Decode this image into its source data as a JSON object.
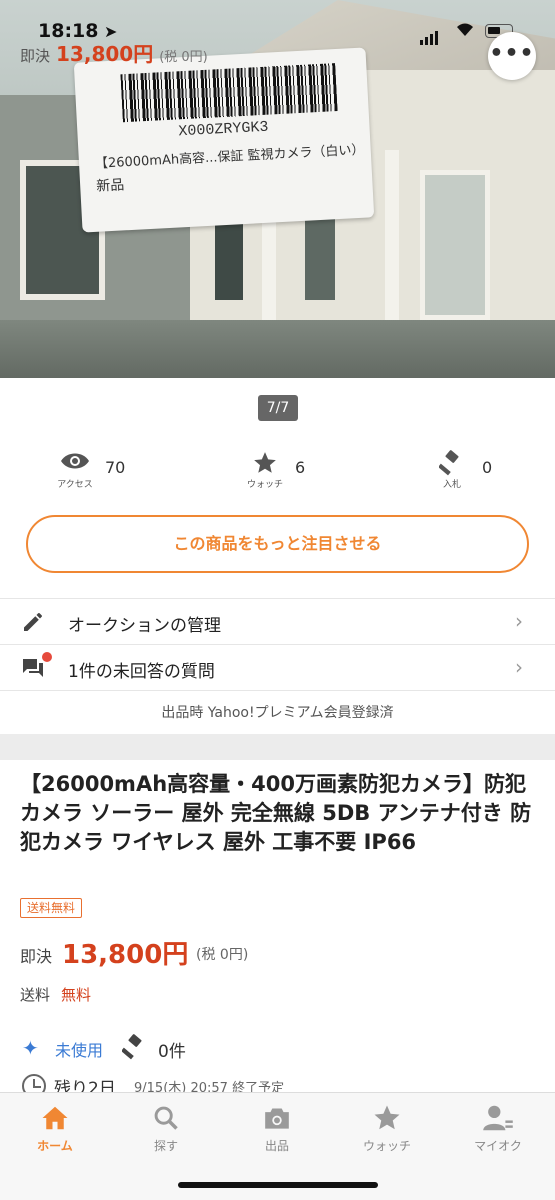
{
  "status_bar": {
    "time": "18:18"
  },
  "header_overlay": {
    "buy_label": "即決",
    "price": "13,800円",
    "tax": "(税 0円)"
  },
  "photo": {
    "sticker_code": "X000ZRYGK3",
    "sticker_line": "【26000mAh高容...保証 監視カメラ（白い）",
    "sticker_condition": "新品"
  },
  "gallery": {
    "counter": "7/7"
  },
  "stats": [
    {
      "icon": "eye-icon",
      "label": "アクセス",
      "value": "70"
    },
    {
      "icon": "star-icon",
      "label": "ウォッチ",
      "value": "6"
    },
    {
      "icon": "gavel-icon",
      "label": "入札",
      "value": "0"
    }
  ],
  "promote_button": "この商品をもっと注目させる",
  "menu_rows": [
    {
      "icon": "pencil-icon",
      "label": "オークションの管理"
    },
    {
      "icon": "chat-icon",
      "label": "1件の未回答の質問"
    }
  ],
  "premium_notice": "出品時 Yahoo!プレミアム会員登録済",
  "item": {
    "title": "【26000mAh高容量・400万画素防犯カメラ】防犯カメラ ソーラー 屋外 完全無線 5DB アンテナ付き 防犯カメラ ワイヤレス 屋外 工事不要 IP66",
    "free_shipping_badge": "送料無料",
    "buy_label": "即決",
    "price": "13,800円",
    "tax": "(税 0円)",
    "shipping_label": "送料",
    "shipping_value": "無料",
    "condition": "未使用",
    "bid_count": "0件",
    "remaining": "残り2日",
    "end_time": "9/15(木) 20:57 終了予定"
  },
  "colors": {
    "accent": "#f08733",
    "price": "#d4411d",
    "link": "#3b7bd4"
  },
  "tabbar": [
    {
      "icon": "home-icon",
      "label": "ホーム",
      "active": true
    },
    {
      "icon": "search-icon",
      "label": "探す",
      "active": false
    },
    {
      "icon": "camera-icon",
      "label": "出品",
      "active": false
    },
    {
      "icon": "star-icon",
      "label": "ウォッチ",
      "active": false
    },
    {
      "icon": "user-icon",
      "label": "マイオク",
      "active": false
    }
  ]
}
